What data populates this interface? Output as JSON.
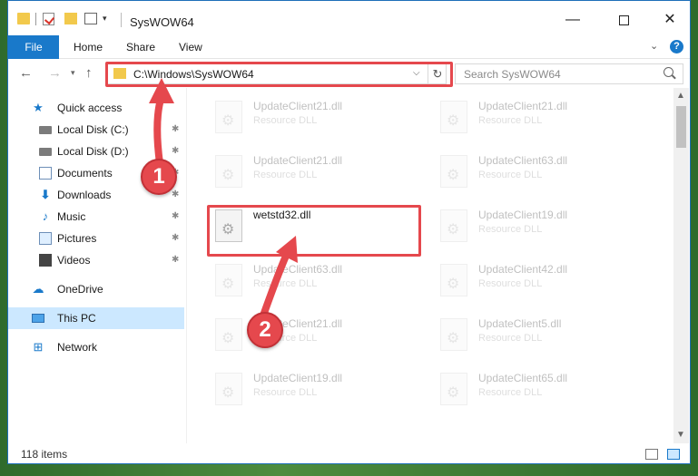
{
  "window": {
    "title": "SysWOW64",
    "minimize_icon": "—",
    "close_icon": "✕"
  },
  "ribbon": {
    "tabs": [
      "File",
      "Home",
      "Share",
      "View"
    ],
    "expand_icon": "chevron-down-icon",
    "help_label": "?"
  },
  "nav": {
    "back_icon": "←",
    "forward_icon": "→",
    "recent_icon": "▾",
    "up_icon": "↑",
    "address": "C:\\Windows\\SysWOW64",
    "address_dropdown": "⌵",
    "refresh_icon": "↻",
    "search_placeholder": "Search SysWOW64"
  },
  "sidebar": {
    "items": [
      {
        "label": "Quick access",
        "icon": "★",
        "pinned": false
      },
      {
        "label": "Local Disk (C:)",
        "icon": "",
        "pinned": true
      },
      {
        "label": "Local Disk (D:)",
        "icon": "",
        "pinned": true
      },
      {
        "label": "Documents",
        "icon": "",
        "pinned": true
      },
      {
        "label": "Downloads",
        "icon": "⬇",
        "pinned": true
      },
      {
        "label": "Music",
        "icon": "♪",
        "pinned": true
      },
      {
        "label": "Pictures",
        "icon": "",
        "pinned": true
      },
      {
        "label": "Videos",
        "icon": "",
        "pinned": true
      },
      {
        "label": "OneDrive",
        "icon": "☁",
        "pinned": false
      },
      {
        "label": "This PC",
        "icon": "",
        "pinned": false
      },
      {
        "label": "Network",
        "icon": "⊞",
        "pinned": false
      }
    ],
    "pin_icon": "📌"
  },
  "files": {
    "left": [
      {
        "name": "UpdateClient21.dll",
        "type": "Resource DLL"
      },
      {
        "name": "UpdateClient21.dll",
        "type": "Resource DLL"
      },
      {
        "name": "wetstd32.dll",
        "type": ""
      },
      {
        "name": "UpdateClient63.dll",
        "type": "Resource DLL"
      },
      {
        "name": "UpdateClient21.dll",
        "type": "Resource DLL"
      },
      {
        "name": "UpdateClient19.dll",
        "type": "Resource DLL"
      }
    ],
    "right": [
      {
        "name": "UpdateClient21.dll",
        "type": "Resource DLL"
      },
      {
        "name": "UpdateClient63.dll",
        "type": "Resource DLL"
      },
      {
        "name": "UpdateClient19.dll",
        "type": "Resource DLL"
      },
      {
        "name": "UpdateClient42.dll",
        "type": "Resource DLL"
      },
      {
        "name": "UpdateClient5.dll",
        "type": "Resource DLL"
      },
      {
        "name": "UpdateClient65.dll",
        "type": "Resource DLL"
      }
    ]
  },
  "status": {
    "item_count": "118 items"
  },
  "annotations": {
    "step1": "1",
    "step2": "2",
    "color": "#e5484d"
  }
}
